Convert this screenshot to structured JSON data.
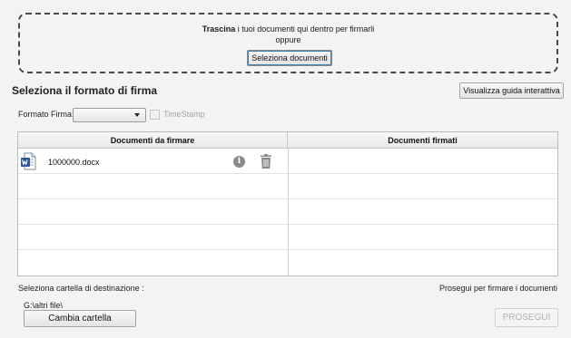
{
  "dropzone": {
    "bold_text": "Trascina",
    "text": " i tuoi documenti qui dentro per firmarli",
    "or_text": "oppure",
    "select_button": "Seleziona documenti"
  },
  "section": {
    "title": "Seleziona il formato di firma",
    "guide_button": "Visualizza guida interattiva"
  },
  "format": {
    "label": "Formato Firma:",
    "selected": "",
    "timestamp_label": "TimeStamp",
    "timestamp_checked": false
  },
  "table": {
    "columns": [
      "Documenti da firmare",
      "Documenti firmati"
    ],
    "rows": [
      {
        "file": "1000000.docx",
        "file_icon": "word-document-icon",
        "signed": ""
      }
    ]
  },
  "footer": {
    "dest_label": "Seleziona cartella di destinazione :",
    "proceed_label": "Prosegui per firmare i documenti",
    "path": "G:\\altri file\\",
    "change_button": "Cambia cartella",
    "next_button": "PROSEGUI"
  },
  "icons": {
    "info": "info-icon",
    "trash": "trash-icon",
    "dropdown": "chevron-down-icon"
  }
}
